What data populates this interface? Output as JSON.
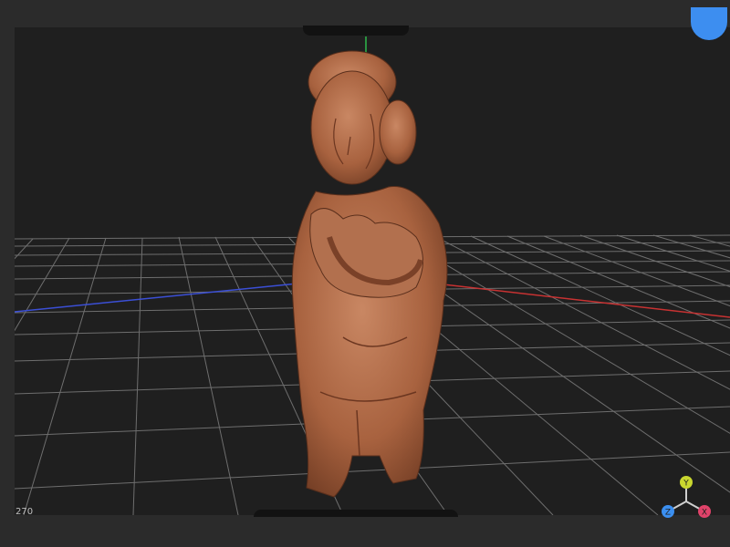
{
  "viewer": {
    "frame_counter": "270",
    "gizmo": {
      "y_label": "Y",
      "x_label": "X",
      "z_label": "Z"
    }
  },
  "colors": {
    "background": "#1f1f1f",
    "frame": "#2b2b2b",
    "grid": "#8a8a8a",
    "axis_x": "#c83232",
    "axis_z": "#3b4fd6",
    "axis_y": "#2fb84b",
    "accent": "#3d8ef0",
    "model": "#b06c4c"
  },
  "icons": {
    "fab": "circle-button-icon",
    "gizmo": "axis-gizmo-icon"
  }
}
